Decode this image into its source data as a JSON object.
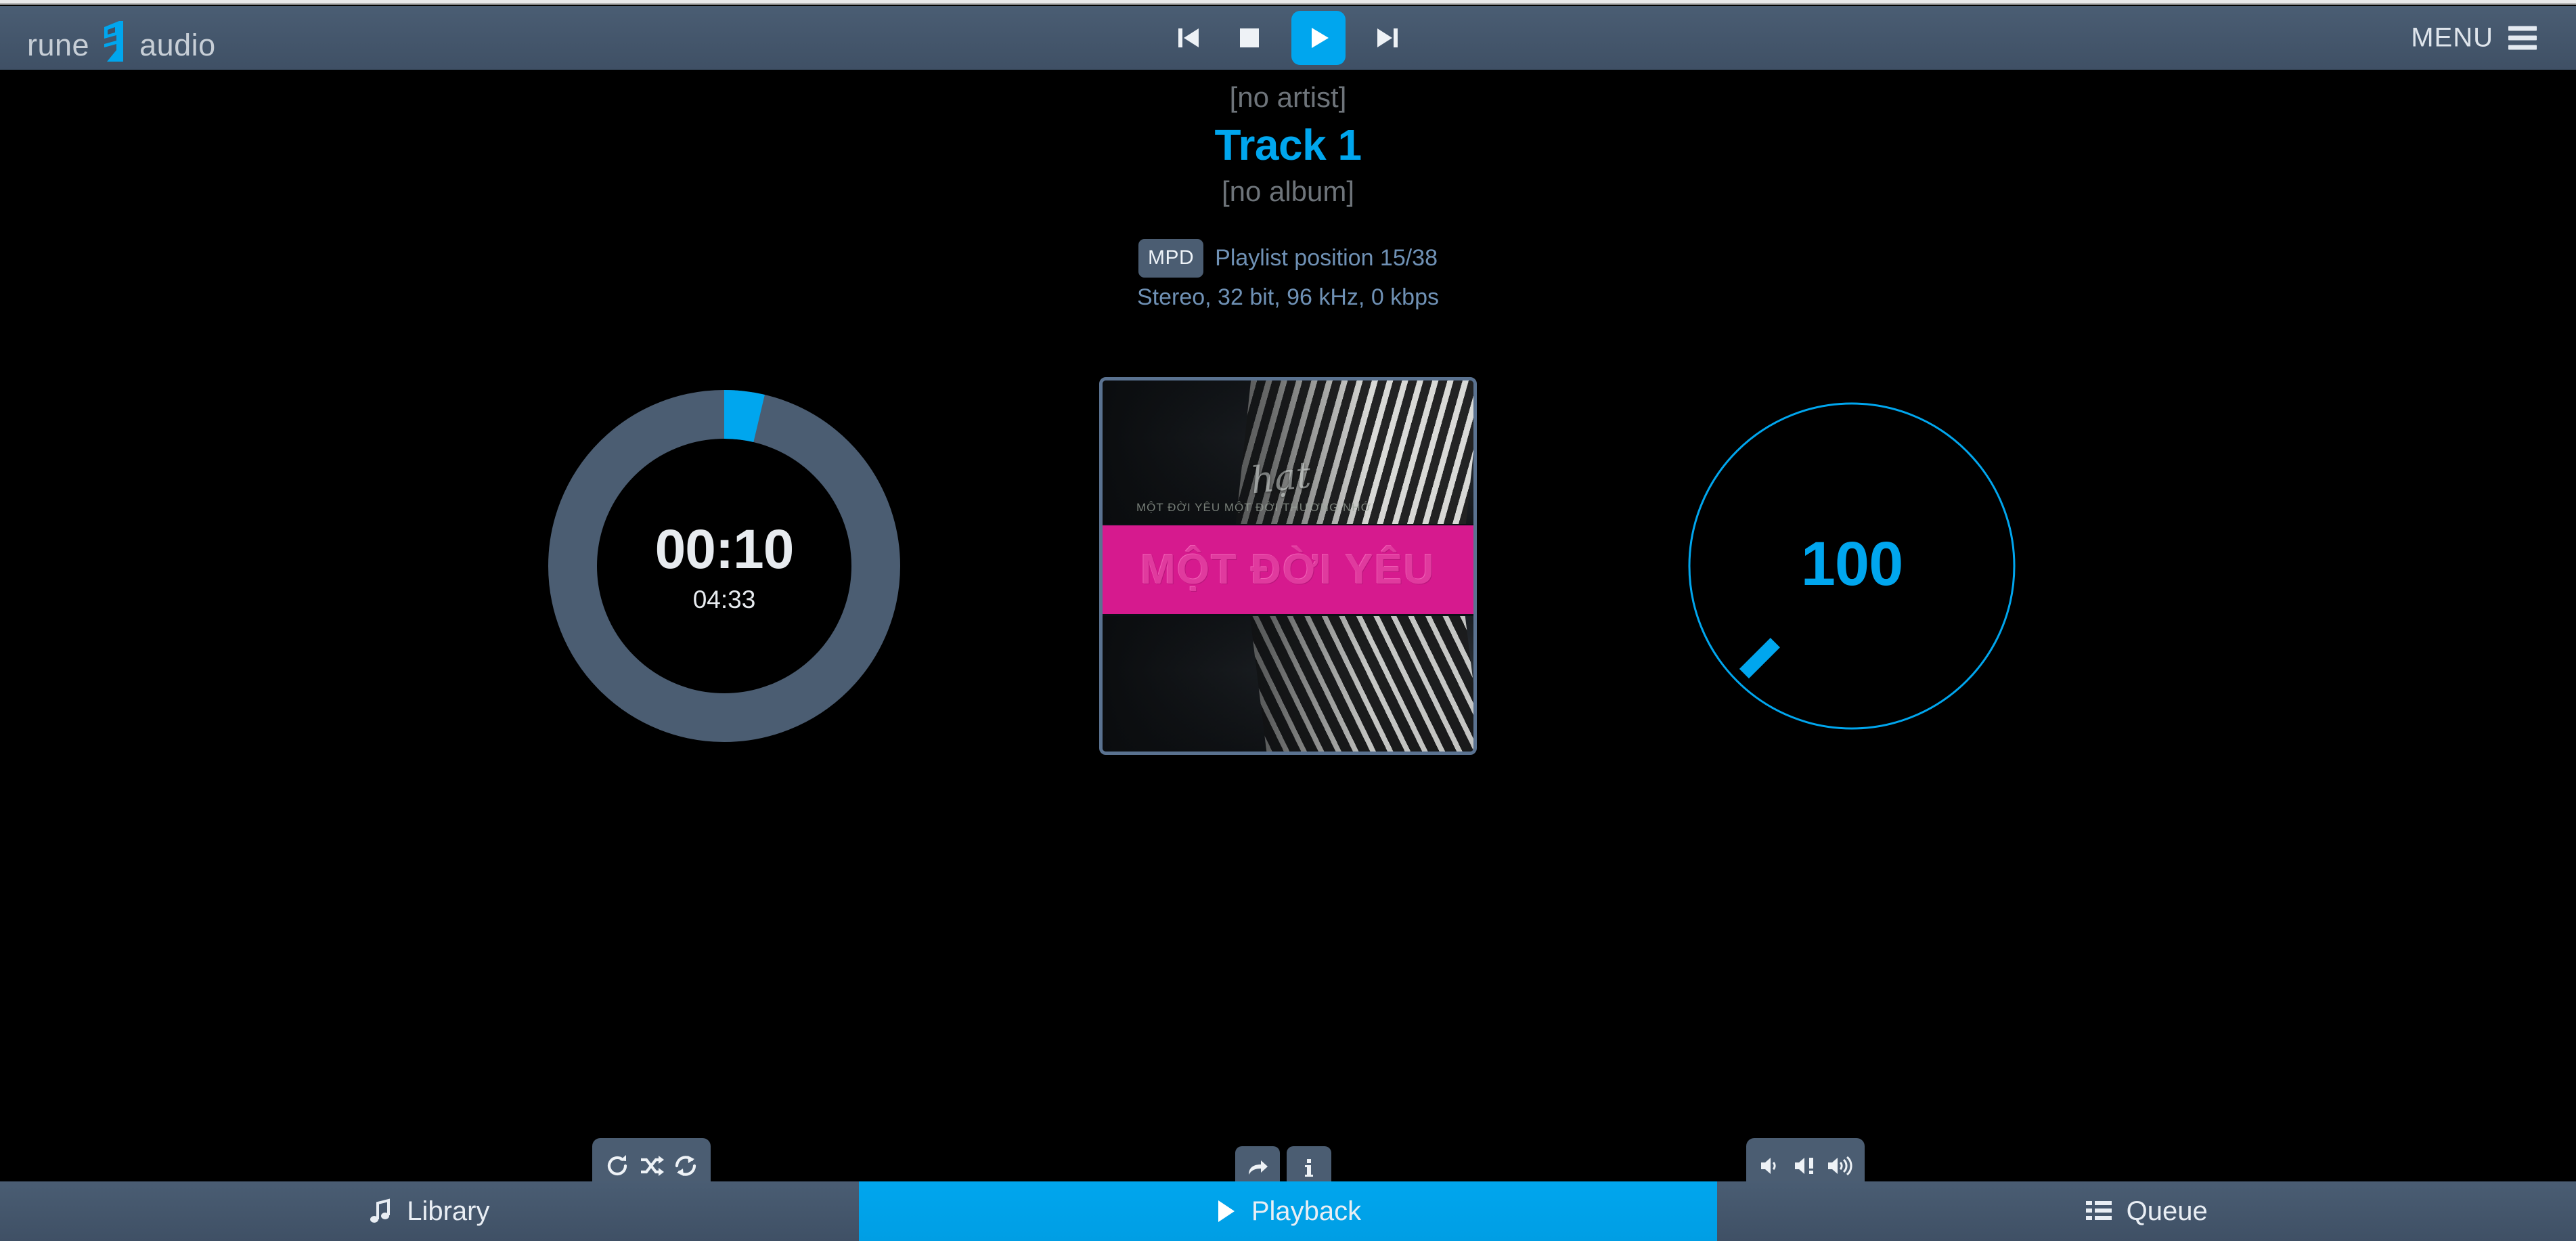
{
  "app": {
    "logo_left": "rune",
    "logo_right": "audio",
    "logo_mark": "rune-glyph"
  },
  "topbar": {
    "prev_label": "previous-track",
    "stop_label": "stop",
    "play_label": "play",
    "next_label": "next-track",
    "menu_label": "MENU",
    "menu_icon": "hamburger-icon",
    "accent_color": "#00a6ee",
    "bar_color": "#4a5d73"
  },
  "track": {
    "artist": "[no artist]",
    "title": "Track 1",
    "album": "[no album]",
    "source_badge": "MPD",
    "playlist_position": "Playlist position 15/38",
    "audio_format": "Stereo, 32 bit, 96 kHz, 0 kbps"
  },
  "progress": {
    "elapsed": "00:10",
    "duration": "04:33",
    "percent": 3.7,
    "track_color": "#4b5d72",
    "fill_color": "#00a6ee",
    "buttons": [
      {
        "name": "repeat-single-icon",
        "label": "repeat-single"
      },
      {
        "name": "shuffle-icon",
        "label": "shuffle"
      },
      {
        "name": "repeat-icon",
        "label": "repeat"
      }
    ]
  },
  "album_art": {
    "band_text": "MỘT ĐỜI YÊU",
    "script_text": "hạt",
    "subtext": "MỘT ĐỜI YÊU MỘT ĐỜI THƯƠNG NHỚ",
    "band_color": "#d61a8e",
    "buttons": [
      {
        "name": "share-icon",
        "label": "share"
      },
      {
        "name": "info-icon",
        "label": "info"
      }
    ]
  },
  "volume": {
    "value": "100",
    "max": 100,
    "ring_color": "#00a6ee",
    "buttons": [
      {
        "name": "volume-down-icon",
        "label": "volume-down"
      },
      {
        "name": "volume-mute-icon",
        "label": "mute"
      },
      {
        "name": "volume-up-icon",
        "label": "volume-up"
      }
    ]
  },
  "bottom_nav": {
    "tabs": [
      {
        "label": "Library",
        "icon": "music-note-icon",
        "active": false
      },
      {
        "label": "Playback",
        "icon": "play-icon",
        "active": true
      },
      {
        "label": "Queue",
        "icon": "list-icon",
        "active": false
      }
    ]
  }
}
